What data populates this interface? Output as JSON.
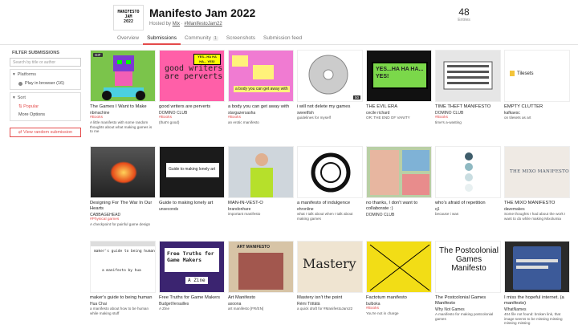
{
  "header": {
    "logo_lines": [
      "MANIFESTO",
      "JAM",
      "2022"
    ],
    "title": "Manifesto Jam 2022",
    "hosted_prefix": "Hosted by",
    "host": "Mix",
    "hashtag": "#ManifestoJam22",
    "entries_count": "48",
    "entries_label": "Entries"
  },
  "tabs": [
    {
      "label": "Overview"
    },
    {
      "label": "Submissions",
      "active": true
    },
    {
      "label": "Community",
      "badge": "1"
    },
    {
      "label": "Screenshots"
    },
    {
      "label": "Submission feed"
    }
  ],
  "sidebar": {
    "title": "FILTER SUBMISSIONS",
    "search_placeholder": "Search by title or author",
    "platforms_label": "Platforms",
    "play_in_browser": "Play in browser (16)",
    "sort_label": "Sort",
    "popular": "Popular",
    "more_options": "More Options",
    "random_label": "View random submission"
  },
  "cards": [
    {
      "title": "The Games I Want to Make",
      "author": "nbmachine",
      "tag": "#Books",
      "desc": "A little manifesto with some random thoughts about what making games is to me",
      "bg": "#79c34a",
      "badge": "GIF"
    },
    {
      "title": "good writers are perverts",
      "author": "DOMINO CLUB",
      "tag": "#Books",
      "desc": "(that's good)",
      "bg": "#ff5fa8"
    },
    {
      "title": "a body you can get away with",
      "author": "stargazersasha",
      "tag": "#Books",
      "desc": "an erotic manifesto",
      "bg": "#f07bd2"
    },
    {
      "title": "i will not delete my games",
      "author": "sweetfish",
      "tag": "",
      "desc": "guidelines for myself",
      "bg": "#cfcfcf",
      "hover": "50"
    },
    {
      "title": "THE EVIL ERA",
      "author": "cecile richard",
      "tag": "OR: THE END OF VANITY",
      "desc": "",
      "bg": "#111"
    },
    {
      "title": "TIME THEFT MANIFESTO",
      "author": "DOMINO CLUB",
      "tag": "#Books",
      "desc": "time's a-wasting",
      "bg": "#e0e0e0"
    },
    {
      "title": "EMPTY CLUTTER",
      "author": "kafkaesc",
      "tag": "",
      "desc": "on tilesets as art",
      "bg": "#fff",
      "thumb_text": "Tilesets"
    },
    {
      "title": "Designing For The War In Our Hearts",
      "author": "CABBAGEHEAD",
      "tag": "#Physical games",
      "desc": "A checkpoint for painful game design",
      "bg": "#3a2a2a"
    },
    {
      "title": "Guide to making lonely art",
      "author": "unseconds",
      "tag": "",
      "desc": "",
      "bg": "#1b1b1b",
      "thumb_text": "Guide to making lonely art"
    },
    {
      "title": "MAN-IN-VEST-O",
      "author": "brandonhare",
      "tag": "",
      "desc": "important manifesto",
      "bg": "#cfd6dc"
    },
    {
      "title": "a manifesto of indulgence",
      "author": "ehronline",
      "tag": "",
      "desc": "what I talk about when I talk about making games",
      "bg": "#fff"
    },
    {
      "title": "no thanks, I don't want to collaborate :)",
      "author": "DOMINO CLUB",
      "tag": "",
      "desc": "",
      "bg": "#b9cfa5"
    },
    {
      "title": "who's afraid of repetition",
      "author": "q1",
      "tag": "",
      "desc": "because i was",
      "bg": "#fff"
    },
    {
      "title": "THE MIXO MANIFESTO",
      "author": "davemakes",
      "tag": "",
      "desc": "Some thoughts I had about the work I want to do while making Mixolumia",
      "bg": "#efeae4",
      "thumb_text": "THE MIXO MANIFESTO"
    },
    {
      "title": "maker's guide to being human",
      "author": "Hua Chai",
      "tag": "",
      "desc": "a manifesto about how to be human while making stuff",
      "bg": "#fff"
    },
    {
      "title": "Free Truths for Game Makers",
      "author": "BudgetVersailles",
      "tag": "",
      "desc": "A Zine",
      "bg": "#3b2470",
      "thumb_text": "Free Truths for Game Makers"
    },
    {
      "title": "Art Manifesto",
      "author": "axoona",
      "tag": "",
      "desc": "art manifesto [FR/EN]",
      "bg": "#d7c4a6"
    },
    {
      "title": "Mastery isn't the point",
      "author": "Rémi Töttätä",
      "tag": "",
      "desc": "a quick draft for #ManifestoJam22",
      "bg": "#efe4d1",
      "thumb_text": "Mastery"
    },
    {
      "title": "Factotum manifesto",
      "author": "bulboka",
      "tag": "#Books",
      "desc": "You're not in charge",
      "bg": "#f2dd16"
    },
    {
      "title": "The Postcolonial Games Manifesto",
      "author": "Why Not Games",
      "tag": "",
      "desc": "A manifesto for making postcolonial games",
      "bg": "#fff",
      "thumb_text": "The Postcolonial Games Manifesto"
    },
    {
      "title": "I miss the hopeful internet. (a manifesto)",
      "author": "WhatNames",
      "tag": "",
      "desc": "404 file not found: broken link, that image seems to be missing missing missing missing",
      "bg": "#222"
    }
  ],
  "thumb_texts": {
    "writers": "good writers are perverts",
    "body": "a body you can get away with",
    "yeshaha": "YES...HA HA HA... YES!",
    "manual_title": "maker's guide to being human",
    "manual_sub": "a manifesto by hua",
    "zine": "A Zine",
    "art_logo": "ART MANIFESTO"
  }
}
